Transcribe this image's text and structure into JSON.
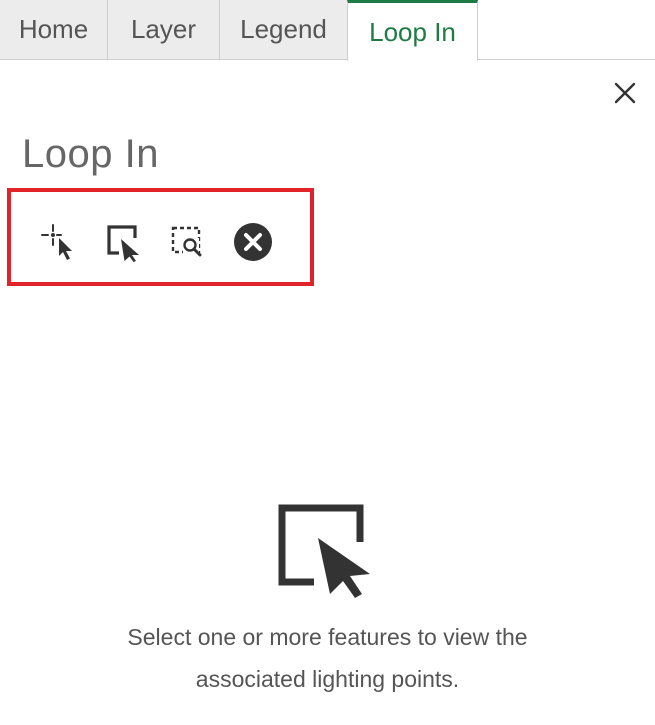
{
  "tabs": [
    {
      "label": "Home",
      "active": false
    },
    {
      "label": "Layer",
      "active": false
    },
    {
      "label": "Legend",
      "active": false
    },
    {
      "label": "Loop In",
      "active": true
    }
  ],
  "panel": {
    "title": "Loop In",
    "close_icon": "close-icon"
  },
  "toolbar": {
    "highlight_color": "#e0242a",
    "tools": [
      {
        "icon": "point-select-icon"
      },
      {
        "icon": "select-feature-icon"
      },
      {
        "icon": "rectangle-zoom-select-icon"
      },
      {
        "icon": "clear-selection-icon"
      }
    ]
  },
  "empty_state": {
    "icon": "select-feature-icon",
    "line1": "Select one or more features to view the",
    "line2": "associated lighting points."
  },
  "colors": {
    "accent": "#1e7b45",
    "tab_bg": "#ececec",
    "text": "#555555"
  }
}
